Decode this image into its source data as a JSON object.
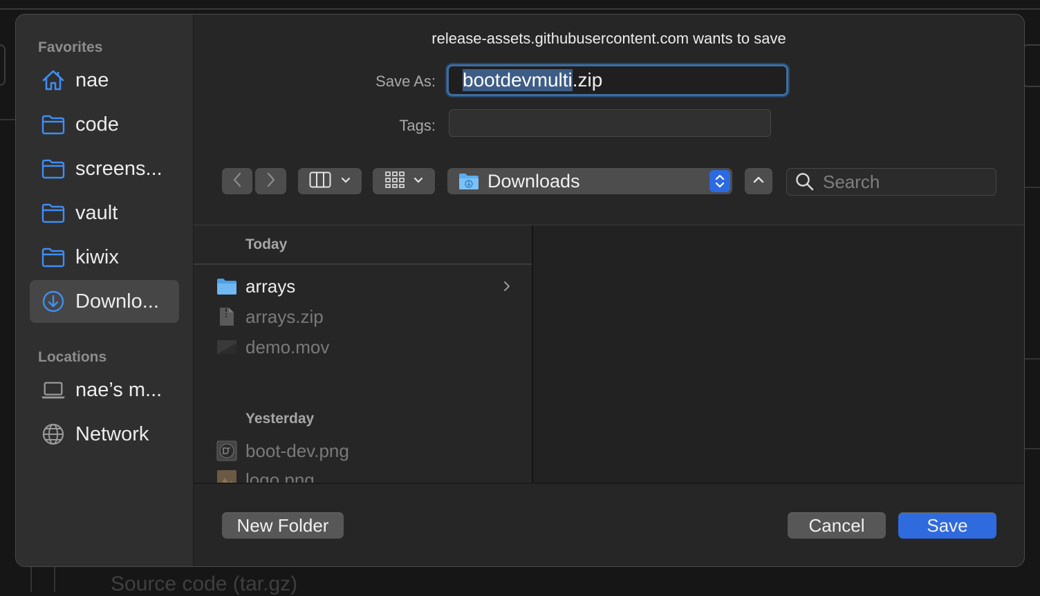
{
  "dialog": {
    "title": "release-assets.githubusercontent.com wants to save",
    "save_as_label": "Save As:",
    "save_as_selected": "bootdevmulti",
    "save_as_extension": ".zip",
    "tags_label": "Tags:",
    "tags_value": "",
    "location": "Downloads",
    "search_placeholder": "Search",
    "new_folder_label": "New Folder",
    "cancel_label": "Cancel",
    "save_label": "Save",
    "accent_color": "#2f6bde"
  },
  "sidebar": {
    "favorites_header": "Favorites",
    "favorites": [
      {
        "label": "nae",
        "icon": "home-icon"
      },
      {
        "label": "code",
        "icon": "folder-icon"
      },
      {
        "label": "screens...",
        "icon": "folder-icon"
      },
      {
        "label": "vault",
        "icon": "folder-icon"
      },
      {
        "label": "kiwix",
        "icon": "folder-icon"
      },
      {
        "label": "Downlo...",
        "icon": "download-icon",
        "selected": true
      }
    ],
    "locations_header": "Locations",
    "locations": [
      {
        "label": "nae’s m...",
        "icon": "laptop-icon"
      },
      {
        "label": "Network",
        "icon": "globe-icon"
      }
    ]
  },
  "browser": {
    "groups": [
      {
        "header": "Today",
        "files": [
          {
            "name": "arrays",
            "icon": "folder-icon",
            "has_children": true,
            "dim": false
          },
          {
            "name": "arrays.zip",
            "icon": "zip-file-icon",
            "dim": true
          },
          {
            "name": "demo.mov",
            "icon": "video-file-icon",
            "dim": true
          }
        ]
      },
      {
        "header": "Yesterday",
        "files": [
          {
            "name": "boot-dev.png",
            "icon": "image-file-icon",
            "dim": true
          },
          {
            "name": "logo.png",
            "icon": "image-file-icon",
            "dim": true
          }
        ]
      }
    ]
  },
  "background": {
    "bottom_text": "Source code (tar.gz)"
  }
}
